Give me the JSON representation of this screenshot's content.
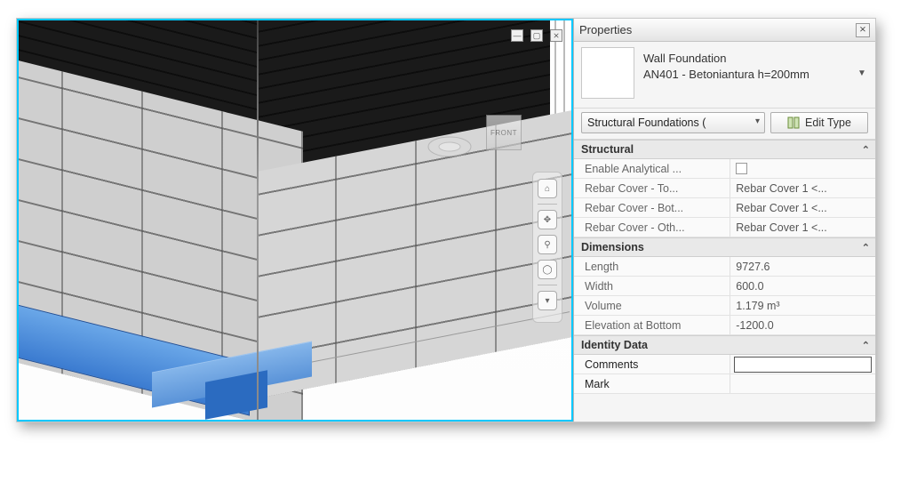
{
  "viewport": {
    "viewcube_face": "FRONT"
  },
  "panel": {
    "title": "Properties",
    "type_family": "Wall Foundation",
    "type_name": "AN401 - Betoniantura h=200mm",
    "category_filter": "Structural Foundations (",
    "edit_type_label": "Edit Type"
  },
  "groups": {
    "structural": {
      "header": "Structural",
      "rows": [
        {
          "label": "Enable Analytical ...",
          "value": "",
          "kind": "checkbox"
        },
        {
          "label": "Rebar Cover - To...",
          "value": "Rebar Cover 1 <..."
        },
        {
          "label": "Rebar Cover - Bot...",
          "value": "Rebar Cover 1 <..."
        },
        {
          "label": "Rebar Cover - Oth...",
          "value": "Rebar Cover 1 <..."
        }
      ]
    },
    "dimensions": {
      "header": "Dimensions",
      "rows": [
        {
          "label": "Length",
          "value": "9727.6"
        },
        {
          "label": "Width",
          "value": "600.0"
        },
        {
          "label": "Volume",
          "value": "1.179 m³"
        },
        {
          "label": "Elevation at Bottom",
          "value": "-1200.0"
        }
      ]
    },
    "identity": {
      "header": "Identity Data",
      "rows": [
        {
          "label": "Comments",
          "value": "",
          "kind": "textinput"
        },
        {
          "label": "Mark",
          "value": ""
        }
      ]
    }
  }
}
